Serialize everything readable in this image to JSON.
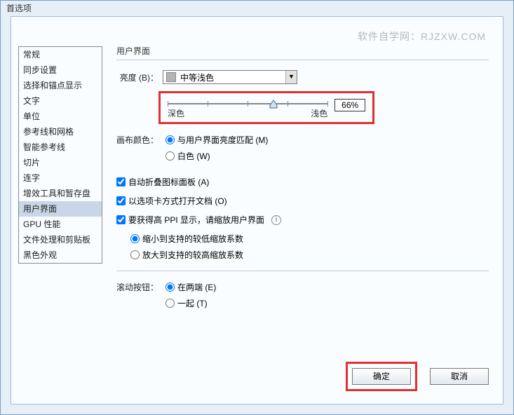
{
  "dialog": {
    "title": "首选项"
  },
  "watermark": "软件自学网：RJZXW.COM",
  "sidebar": {
    "items": [
      {
        "label": "常规"
      },
      {
        "label": "同步设置"
      },
      {
        "label": "选择和锚点显示"
      },
      {
        "label": "文字"
      },
      {
        "label": "单位"
      },
      {
        "label": "参考线和网格"
      },
      {
        "label": "智能参考线"
      },
      {
        "label": "切片"
      },
      {
        "label": "连字"
      },
      {
        "label": "增效工具和暂存盘"
      },
      {
        "label": "用户界面"
      },
      {
        "label": "GPU 性能"
      },
      {
        "label": "文件处理和剪贴板"
      },
      {
        "label": "黑色外观"
      }
    ],
    "selected_index": 10
  },
  "main": {
    "header": "用户界面",
    "brightness": {
      "label": "亮度 (B)：",
      "selected": "中等浅色",
      "slider": {
        "value_text": "66%",
        "percent": 66,
        "min_label": "深色",
        "max_label": "浅色"
      }
    },
    "canvas_color": {
      "label": "画布颜色：",
      "options": [
        {
          "label": "与用户界面亮度匹配 (M)",
          "checked": true
        },
        {
          "label": "白色 (W)",
          "checked": false
        }
      ]
    },
    "auto_collapse": {
      "label": "自动折叠图标面板 (A)",
      "checked": true
    },
    "open_tabs": {
      "label": "以选项卡方式打开文档 (O)",
      "checked": true
    },
    "high_ppi": {
      "label": "要获得高 PPI 显示，请缩放用户界面",
      "checked": true,
      "options": [
        {
          "label": "缩小到支持的较低缩放系数",
          "checked": true
        },
        {
          "label": "放大到支持的较高缩放系数",
          "checked": false
        }
      ]
    },
    "scroll_buttons": {
      "label": "滚动按钮：",
      "options": [
        {
          "label": "在两端 (E)",
          "checked": true
        },
        {
          "label": "一起 (T)",
          "checked": false
        }
      ]
    }
  },
  "buttons": {
    "ok": "确定",
    "cancel": "取消"
  }
}
